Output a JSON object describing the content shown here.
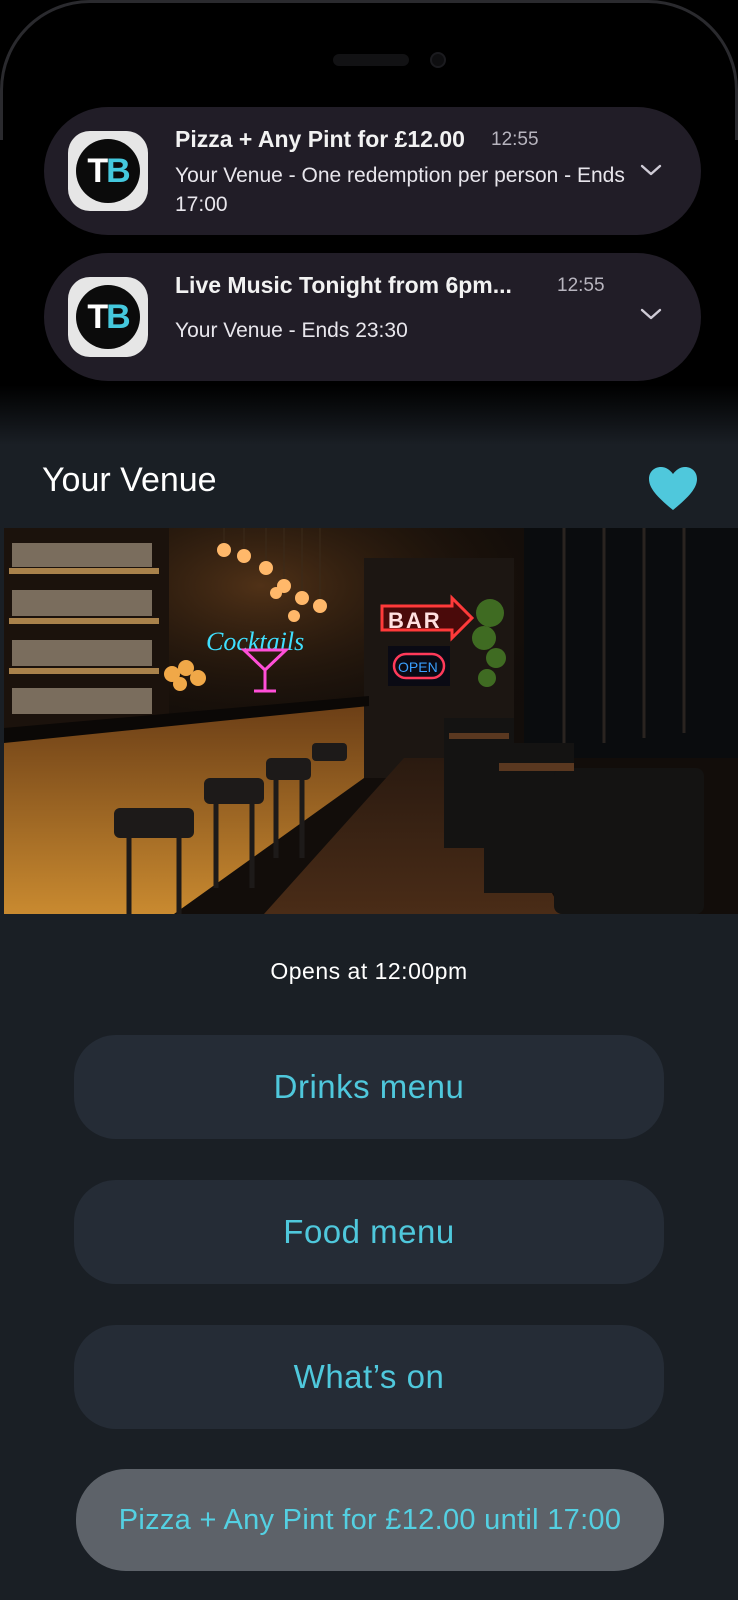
{
  "notifications": [
    {
      "app_icon_letters": [
        "T",
        "B"
      ],
      "title": "Pizza + Any Pint for £12.00",
      "time": "12:55",
      "body": "Your Venue - One redemption per person - Ends 17:00"
    },
    {
      "app_icon_letters": [
        "T",
        "B"
      ],
      "title": "Live Music Tonight from 6pm...",
      "time": "12:55",
      "body": "Your Venue - Ends 23:30"
    }
  ],
  "venue": {
    "name": "Your Venue",
    "favorite_icon": "heart-icon",
    "photo_signs": {
      "cocktails": "Cocktails",
      "bar": "BAR",
      "open": "OPEN"
    },
    "opening_text": "Opens at 12:00pm"
  },
  "actions": {
    "drinks_menu": "Drinks menu",
    "food_menu": "Food menu",
    "whats_on": "What’s on",
    "offer": "Pizza + Any Pint for £12.00 until 17:00"
  },
  "colors": {
    "accent": "#4fc8dc",
    "background": "#1a1f25",
    "button": "#252c36",
    "offer_button": "#5d6269",
    "notification_bg": "#211d27"
  }
}
